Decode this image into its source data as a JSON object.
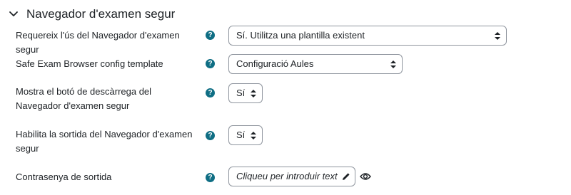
{
  "section": {
    "title": "Navegador d'examen segur",
    "icon": "chevron-down-icon"
  },
  "help_glyph": "?",
  "rows": [
    {
      "label": "Requereix l'ús del Navegador d'examen segur",
      "value": "Sí. Utilitza una plantilla existent"
    },
    {
      "label": "Safe Exam Browser config template",
      "value": "Configuració Aules"
    },
    {
      "label": "Mostra el botó de descàrrega del Navegador d'examen segur",
      "value": "Sí"
    },
    {
      "label": "Habilita la sortida del Navegador d'examen segur",
      "value": "Sí"
    },
    {
      "label": "Contrasenya de sortida",
      "placeholder": "Cliqueu per introduir text"
    }
  ],
  "colors": {
    "help": "#0f6e84",
    "border": "#8f959e",
    "text": "#1d2125"
  }
}
